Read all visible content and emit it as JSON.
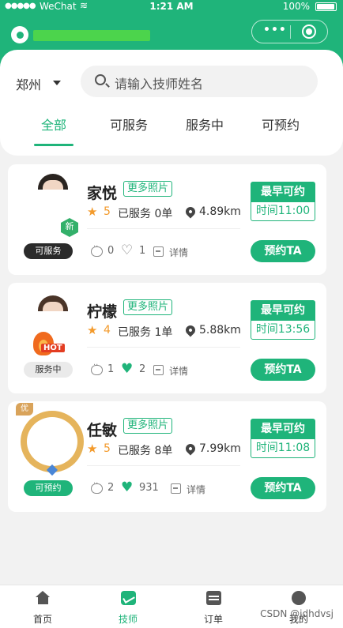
{
  "statusbar": {
    "dots": "●●●●●",
    "carrier": "WeChat",
    "time": "1:21 AM",
    "battery": "100%"
  },
  "header": {
    "more_glyph": "•••"
  },
  "filter": {
    "city": "郑州",
    "search_placeholder": "请输入技师姓名"
  },
  "tabs": [
    {
      "label": "全部"
    },
    {
      "label": "可服务"
    },
    {
      "label": "服务中"
    },
    {
      "label": "可预约"
    }
  ],
  "technicians": [
    {
      "name": "家悦",
      "more_photos": "更多照片",
      "status": "可服务",
      "badge": "新",
      "rating": "5",
      "served": "已服务 0单",
      "distance": "4.89km",
      "messages": "0",
      "likes": "1",
      "detail": "详情",
      "earliest_label": "最早可约",
      "earliest_time": "时间11:00",
      "book": "预约TA"
    },
    {
      "name": "柠檬",
      "more_photos": "更多照片",
      "status": "服务中",
      "badge": "HOT",
      "rating": "4",
      "served": "已服务 1单",
      "distance": "5.88km",
      "messages": "1",
      "likes": "2",
      "detail": "详情",
      "earliest_label": "最早可约",
      "earliest_time": "时间13:56",
      "book": "预约TA"
    },
    {
      "name": "任敏",
      "more_photos": "更多照片",
      "status": "可预约",
      "badge": "优",
      "rating": "5",
      "served": "已服务 8单",
      "distance": "7.99km",
      "messages": "2",
      "likes": "931",
      "detail": "详情",
      "earliest_label": "最早可约",
      "earliest_time": "时间11:08",
      "book": "预约TA"
    }
  ],
  "nav": [
    {
      "label": "首页",
      "icon": "home-icon"
    },
    {
      "label": "技师",
      "icon": "technician-icon"
    },
    {
      "label": "订单",
      "icon": "order-icon"
    },
    {
      "label": "我的",
      "icon": "profile-icon"
    }
  ],
  "watermark": "CSDN @jdhdvsj",
  "colors": {
    "primary": "#1fb47a",
    "rating": "#f39a2b"
  }
}
